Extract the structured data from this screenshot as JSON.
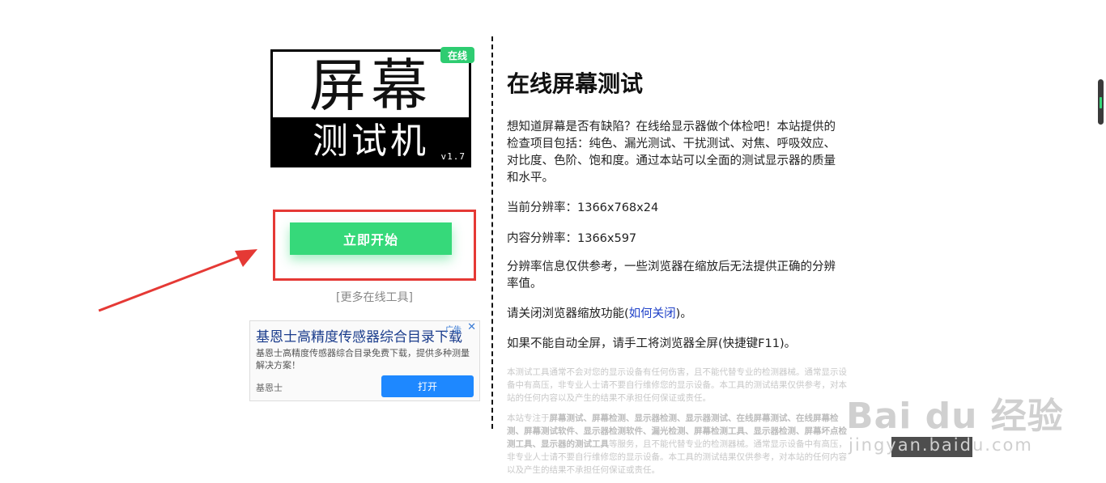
{
  "logo": {
    "line1": "屏幕",
    "line2": "测试机",
    "version": "v1.7",
    "badge": "在线"
  },
  "left": {
    "start_button": "立即开始",
    "more_tools": "[更多在线工具]"
  },
  "ad": {
    "title": "基恩士高精度传感器综合目录下载",
    "tag": "广告",
    "close": "✕",
    "description": "基恩士高精度传感器综合目录免费下载，提供多种测量解决方案！",
    "brand": "基恩士",
    "open_button": "打开"
  },
  "content": {
    "title": "在线屏幕测试",
    "intro": "想知道屏幕是否有缺陷？在线给显示器做个体检吧！本站提供的检查项目包括：纯色、漏光测试、干扰测试、对焦、呼吸效应、对比度、色阶、饱和度。通过本站可以全面的测试显示器的质量和水平。",
    "current_resolution": "当前分辨率：1366x768x24",
    "content_resolution": "内容分辨率：1366x597",
    "resolution_note": "分辨率信息仅供参考，一些浏览器在缩放后无法提供正确的分辨率值。",
    "zoom_prefix": "请关闭浏览器缩放功能(",
    "zoom_link": "如何关闭",
    "zoom_suffix": ")。",
    "fullscreen": "如果不能自动全屏，请手工将浏览器全屏(快捷键F11)。",
    "disclaimer1": "本测试工具通常不会对您的显示设备有任何伤害，且不能代替专业的检测器械。通常显示设备中有高压，非专业人士请不要自行维修您的显示设备。本工具的测试结果仅供参考，对本站的任何内容以及产生的结果不承担任何保证或责任。",
    "disclaimer2_prefix": "本站专注于",
    "disclaimer2_bold": "屏幕测试、屏幕检测、显示器检测、显示器测试、在线屏幕测试、在线屏幕检测、屏幕测试软件、显示器检测软件、漏光检测、屏幕检测工具、显示器检测、屏幕坏点检测工具、显示器的测试工具",
    "disclaimer2_suffix": "等服务，且不能代替专业的检测器械。通常显示设备中有高压，非专业人士请不要自行维修您的显示设备。本工具的测试结果仅供参考，对本站的任何内容以及产生的结果不承担任何保证或责任。"
  },
  "watermark": {
    "logo": "Bai du 经验",
    "sub": "jingyan.baidu.com"
  },
  "colors": {
    "accent_green": "#36d97a",
    "highlight_red": "#e53935",
    "link_blue": "#1e40c8"
  }
}
